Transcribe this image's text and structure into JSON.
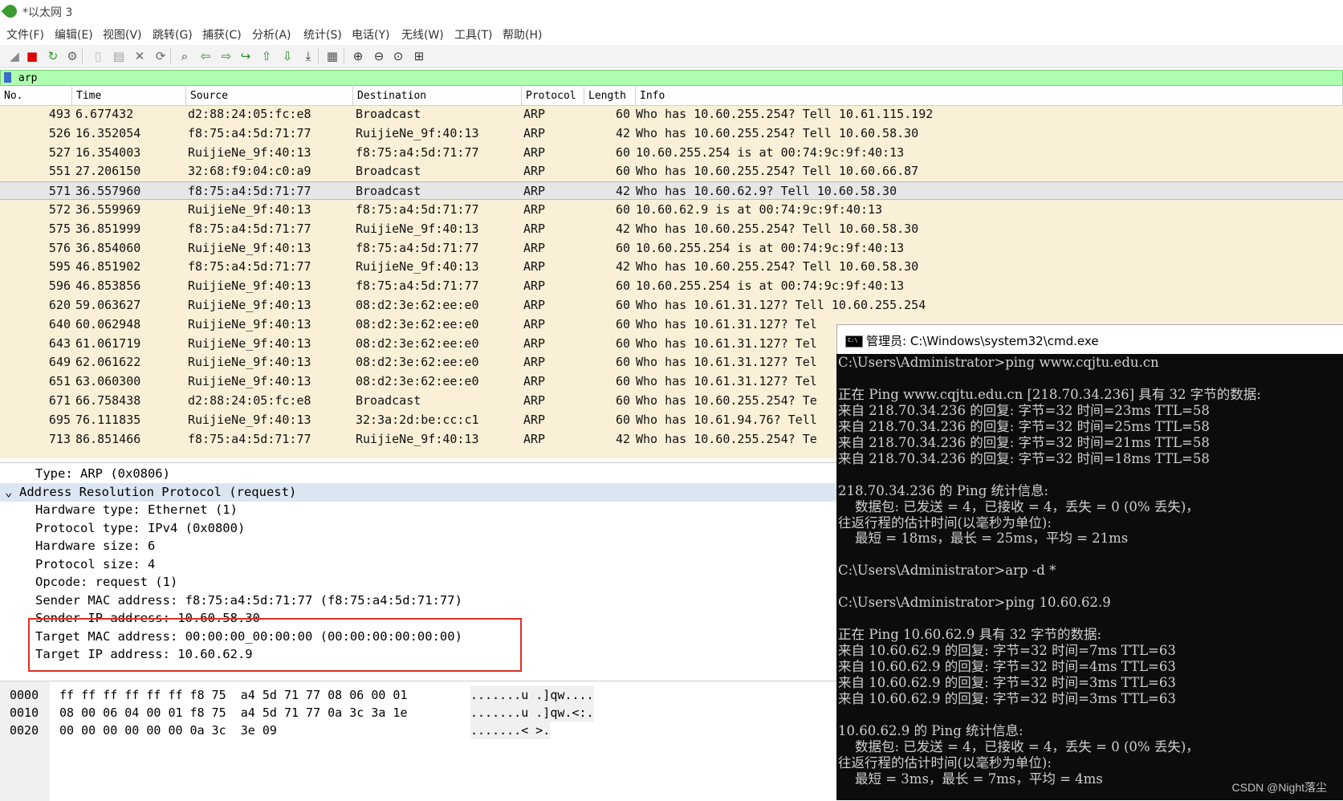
{
  "window": {
    "title": "*以太网 3"
  },
  "menu": [
    "文件(F)",
    "编辑(E)",
    "视图(V)",
    "跳转(G)",
    "捕获(C)",
    "分析(A)",
    "统计(S)",
    "电话(Y)",
    "无线(W)",
    "工具(T)",
    "帮助(H)"
  ],
  "toolbar": {
    "icons": [
      "shark-fin-start-icon",
      "stop-capture-icon",
      "restart-capture-icon",
      "capture-options-icon",
      "open-file-icon",
      "save-file-icon",
      "close-file-icon",
      "reload-icon",
      "find-packet-icon",
      "go-back-icon",
      "go-forward-icon",
      "go-to-packet-icon",
      "first-packet-icon",
      "last-packet-icon",
      "autoscroll-icon",
      "colorize-icon",
      "zoom-in-icon",
      "zoom-out-icon",
      "normal-size-icon",
      "resize-columns-icon"
    ]
  },
  "filter": {
    "value": "arp"
  },
  "packet_list": {
    "columns": [
      "No.",
      "Time",
      "Source",
      "Destination",
      "Protocol",
      "Length",
      "Info"
    ],
    "selected_index": 4,
    "rows": [
      {
        "no": "493",
        "time": "6.677432",
        "src": "d2:88:24:05:fc:e8",
        "dst": "Broadcast",
        "proto": "ARP",
        "len": "60",
        "info": "Who has 10.60.255.254? Tell 10.61.115.192"
      },
      {
        "no": "526",
        "time": "16.352054",
        "src": "f8:75:a4:5d:71:77",
        "dst": "RuijieNe_9f:40:13",
        "proto": "ARP",
        "len": "42",
        "info": "Who has 10.60.255.254? Tell 10.60.58.30"
      },
      {
        "no": "527",
        "time": "16.354003",
        "src": "RuijieNe_9f:40:13",
        "dst": "f8:75:a4:5d:71:77",
        "proto": "ARP",
        "len": "60",
        "info": "10.60.255.254 is at 00:74:9c:9f:40:13"
      },
      {
        "no": "551",
        "time": "27.206150",
        "src": "32:68:f9:04:c0:a9",
        "dst": "Broadcast",
        "proto": "ARP",
        "len": "60",
        "info": "Who has 10.60.255.254? Tell 10.60.66.87"
      },
      {
        "no": "571",
        "time": "36.557960",
        "src": "f8:75:a4:5d:71:77",
        "dst": "Broadcast",
        "proto": "ARP",
        "len": "42",
        "info": "Who has 10.60.62.9? Tell 10.60.58.30"
      },
      {
        "no": "572",
        "time": "36.559969",
        "src": "RuijieNe_9f:40:13",
        "dst": "f8:75:a4:5d:71:77",
        "proto": "ARP",
        "len": "60",
        "info": "10.60.62.9 is at 00:74:9c:9f:40:13"
      },
      {
        "no": "575",
        "time": "36.851999",
        "src": "f8:75:a4:5d:71:77",
        "dst": "RuijieNe_9f:40:13",
        "proto": "ARP",
        "len": "42",
        "info": "Who has 10.60.255.254? Tell 10.60.58.30"
      },
      {
        "no": "576",
        "time": "36.854060",
        "src": "RuijieNe_9f:40:13",
        "dst": "f8:75:a4:5d:71:77",
        "proto": "ARP",
        "len": "60",
        "info": "10.60.255.254 is at 00:74:9c:9f:40:13"
      },
      {
        "no": "595",
        "time": "46.851902",
        "src": "f8:75:a4:5d:71:77",
        "dst": "RuijieNe_9f:40:13",
        "proto": "ARP",
        "len": "42",
        "info": "Who has 10.60.255.254? Tell 10.60.58.30"
      },
      {
        "no": "596",
        "time": "46.853856",
        "src": "RuijieNe_9f:40:13",
        "dst": "f8:75:a4:5d:71:77",
        "proto": "ARP",
        "len": "60",
        "info": "10.60.255.254 is at 00:74:9c:9f:40:13"
      },
      {
        "no": "620",
        "time": "59.063627",
        "src": "RuijieNe_9f:40:13",
        "dst": "08:d2:3e:62:ee:e0",
        "proto": "ARP",
        "len": "60",
        "info": "Who has 10.61.31.127? Tell 10.60.255.254"
      },
      {
        "no": "640",
        "time": "60.062948",
        "src": "RuijieNe_9f:40:13",
        "dst": "08:d2:3e:62:ee:e0",
        "proto": "ARP",
        "len": "60",
        "info": "Who has 10.61.31.127? Tel"
      },
      {
        "no": "643",
        "time": "61.061719",
        "src": "RuijieNe_9f:40:13",
        "dst": "08:d2:3e:62:ee:e0",
        "proto": "ARP",
        "len": "60",
        "info": "Who has 10.61.31.127? Tel"
      },
      {
        "no": "649",
        "time": "62.061622",
        "src": "RuijieNe_9f:40:13",
        "dst": "08:d2:3e:62:ee:e0",
        "proto": "ARP",
        "len": "60",
        "info": "Who has 10.61.31.127? Tel"
      },
      {
        "no": "651",
        "time": "63.060300",
        "src": "RuijieNe_9f:40:13",
        "dst": "08:d2:3e:62:ee:e0",
        "proto": "ARP",
        "len": "60",
        "info": "Who has 10.61.31.127? Tel"
      },
      {
        "no": "671",
        "time": "66.758438",
        "src": "d2:88:24:05:fc:e8",
        "dst": "Broadcast",
        "proto": "ARP",
        "len": "60",
        "info": "Who has 10.60.255.254? Te"
      },
      {
        "no": "695",
        "time": "76.111835",
        "src": "RuijieNe_9f:40:13",
        "dst": "32:3a:2d:be:cc:c1",
        "proto": "ARP",
        "len": "60",
        "info": "Who has 10.61.94.76? Tell"
      },
      {
        "no": "713",
        "time": "86.851466",
        "src": "f8:75:a4:5d:71:77",
        "dst": "RuijieNe_9f:40:13",
        "proto": "ARP",
        "len": "42",
        "info": "Who has 10.60.255.254? Te"
      }
    ]
  },
  "details": {
    "lines": [
      {
        "indent": "    ",
        "text": "Type: ARP (0x0806)"
      },
      {
        "indent": "",
        "text": "Address Resolution Protocol (request)",
        "expander": "v",
        "highlight": true
      },
      {
        "indent": "    ",
        "text": "Hardware type: Ethernet (1)"
      },
      {
        "indent": "    ",
        "text": "Protocol type: IPv4 (0x0800)"
      },
      {
        "indent": "    ",
        "text": "Hardware size: 6"
      },
      {
        "indent": "    ",
        "text": "Protocol size: 4"
      },
      {
        "indent": "    ",
        "text": "Opcode: request (1)"
      },
      {
        "indent": "    ",
        "text": "Sender MAC address: f8:75:a4:5d:71:77 (f8:75:a4:5d:71:77)"
      },
      {
        "indent": "    ",
        "text": "Sender IP address: 10.60.58.30"
      },
      {
        "indent": "    ",
        "text": "Target MAC address: 00:00:00_00:00:00 (00:00:00:00:00:00)"
      },
      {
        "indent": "    ",
        "text": "Target IP address: 10.60.62.9"
      }
    ]
  },
  "bytes": {
    "lines": [
      {
        "offset": "0000",
        "hex": "ff ff ff ff ff ff f8 75  a4 5d 71 77 08 06 00 01",
        "ascii": ".......u .]qw...."
      },
      {
        "offset": "0010",
        "hex": "08 00 06 04 00 01 f8 75  a4 5d 71 77 0a 3c 3a 1e",
        "ascii": ".......u .]qw.<:."
      },
      {
        "offset": "0020",
        "hex": "00 00 00 00 00 00 0a 3c  3e 09",
        "ascii": ".......< >."
      }
    ]
  },
  "cmd": {
    "title": "管理员: C:\\Windows\\system32\\cmd.exe",
    "lines": [
      "C:\\Users\\Administrator>ping www.cqjtu.edu.cn",
      "",
      "正在 Ping www.cqjtu.edu.cn [218.70.34.236] 具有 32 字节的数据:",
      "来自 218.70.34.236 的回复: 字节=32 时间=23ms TTL=58",
      "来自 218.70.34.236 的回复: 字节=32 时间=25ms TTL=58",
      "来自 218.70.34.236 的回复: 字节=32 时间=21ms TTL=58",
      "来自 218.70.34.236 的回复: 字节=32 时间=18ms TTL=58",
      "",
      "218.70.34.236 的 Ping 统计信息:",
      "    数据包: 已发送 = 4，已接收 = 4，丢失 = 0 (0% 丢失)，",
      "往返行程的估计时间(以毫秒为单位):",
      "    最短 = 18ms，最长 = 25ms，平均 = 21ms",
      "",
      "C:\\Users\\Administrator>arp -d *",
      "",
      "C:\\Users\\Administrator>ping 10.60.62.9",
      "",
      "正在 Ping 10.60.62.9 具有 32 字节的数据:",
      "来自 10.60.62.9 的回复: 字节=32 时间=7ms TTL=63",
      "来自 10.60.62.9 的回复: 字节=32 时间=4ms TTL=63",
      "来自 10.60.62.9 的回复: 字节=32 时间=3ms TTL=63",
      "来自 10.60.62.9 的回复: 字节=32 时间=3ms TTL=63",
      "",
      "10.60.62.9 的 Ping 统计信息:",
      "    数据包: 已发送 = 4，已接收 = 4，丢失 = 0 (0% 丢失)，",
      "往返行程的估计时间(以毫秒为单位):",
      "    最短 = 3ms，最长 = 7ms，平均 = 4ms"
    ]
  },
  "watermark": "CSDN @Night落尘"
}
